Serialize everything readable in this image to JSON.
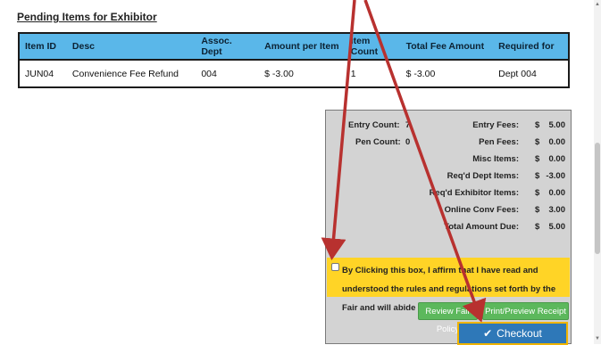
{
  "section": {
    "title": "Pending Items for Exhibitor"
  },
  "table": {
    "columns": [
      "Item ID",
      "Desc",
      "Assoc. Dept",
      "Amount per Item",
      "Item Count",
      "Total Fee Amount",
      "Required for"
    ],
    "rows": [
      [
        "JUN04",
        "Convenience Fee Refund",
        "004",
        "$ -3.00",
        "1",
        "$ -3.00",
        "Dept 004"
      ]
    ]
  },
  "summary": {
    "entry_count_label": "Entry Count:",
    "entry_count_value": "7",
    "pen_count_label": "Pen Count:",
    "pen_count_value": "0",
    "fees": [
      {
        "label": "Entry Fees:",
        "currency": "$",
        "value": "5.00"
      },
      {
        "label": "Pen Fees:",
        "currency": "$",
        "value": "0.00"
      },
      {
        "label": "Misc Items:",
        "currency": "$",
        "value": "0.00"
      },
      {
        "label": "Req'd Dept Items:",
        "currency": "$",
        "value": "-3.00"
      },
      {
        "label": "Req'd Exhibitor Items:",
        "currency": "$",
        "value": "0.00"
      },
      {
        "label": "Online Conv Fees:",
        "currency": "$",
        "value": "3.00"
      },
      {
        "label": "Total Amount Due:",
        "currency": "$",
        "value": "5.00"
      }
    ],
    "affirm_text": "By Clicking this box, I affirm that I have read and understood the rules and regulations set forth by the Fair and will abide by them.",
    "affirm_checked": false,
    "review_button": "Review Fair Policy",
    "print_button": "Print/Preview Receipt",
    "checkout_button": "Checkout",
    "checkout_icon": "check-icon"
  },
  "annotations": {
    "arrow_color": "#b8312f"
  },
  "colors": {
    "table_header": "#5ab7e9",
    "affirm_highlight": "#ffd426",
    "green_button": "#5cb85c",
    "checkout_button": "#2e78b8"
  }
}
